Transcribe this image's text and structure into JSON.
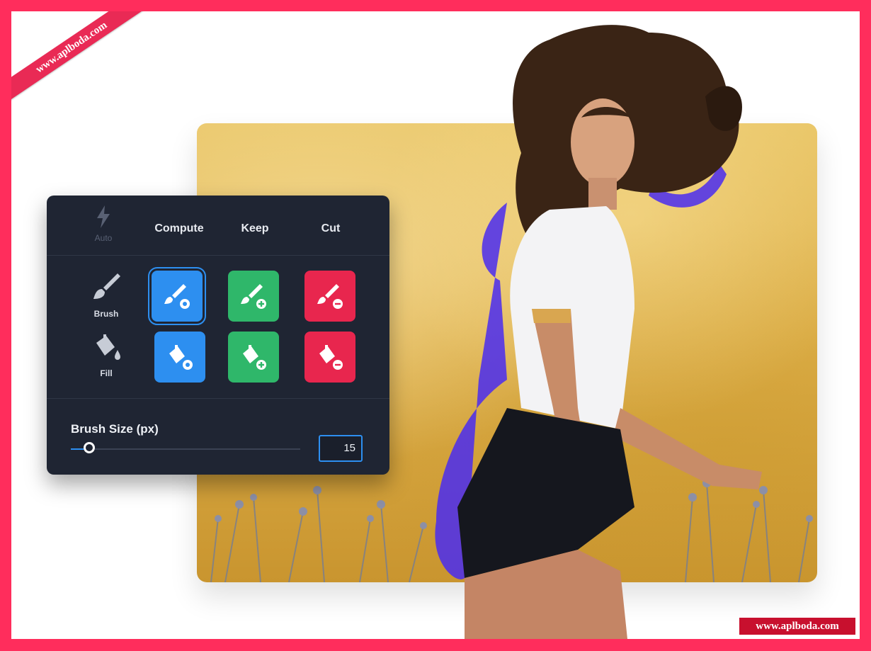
{
  "watermark": {
    "ribbon": "www.aplboda.com",
    "badge": "www.aplboda.com"
  },
  "colors": {
    "compute": "#2d8ff0",
    "keep": "#2fb76a",
    "cut": "#e8264e",
    "panel_bg": "#1f2533",
    "frame": "#ff2d5c"
  },
  "panel": {
    "header": {
      "auto": {
        "label": "Auto",
        "icon": "lightning-icon",
        "enabled": false
      },
      "columns": [
        "Compute",
        "Keep",
        "Cut"
      ]
    },
    "rows": [
      {
        "label": "Brush",
        "icon": "brush-icon",
        "tools": [
          {
            "mode": "compute",
            "icon": "brush-gear-icon",
            "selected": true
          },
          {
            "mode": "keep",
            "icon": "brush-plus-icon",
            "selected": false
          },
          {
            "mode": "cut",
            "icon": "brush-minus-icon",
            "selected": false
          }
        ]
      },
      {
        "label": "Fill",
        "icon": "paint-bucket-icon",
        "tools": [
          {
            "mode": "compute",
            "icon": "bucket-gear-icon",
            "selected": false
          },
          {
            "mode": "keep",
            "icon": "bucket-plus-icon",
            "selected": false
          },
          {
            "mode": "cut",
            "icon": "bucket-minus-icon",
            "selected": false
          }
        ]
      }
    ],
    "brush_size": {
      "label": "Brush Size (px)",
      "value": "15",
      "slider_fraction": 0.08
    }
  }
}
